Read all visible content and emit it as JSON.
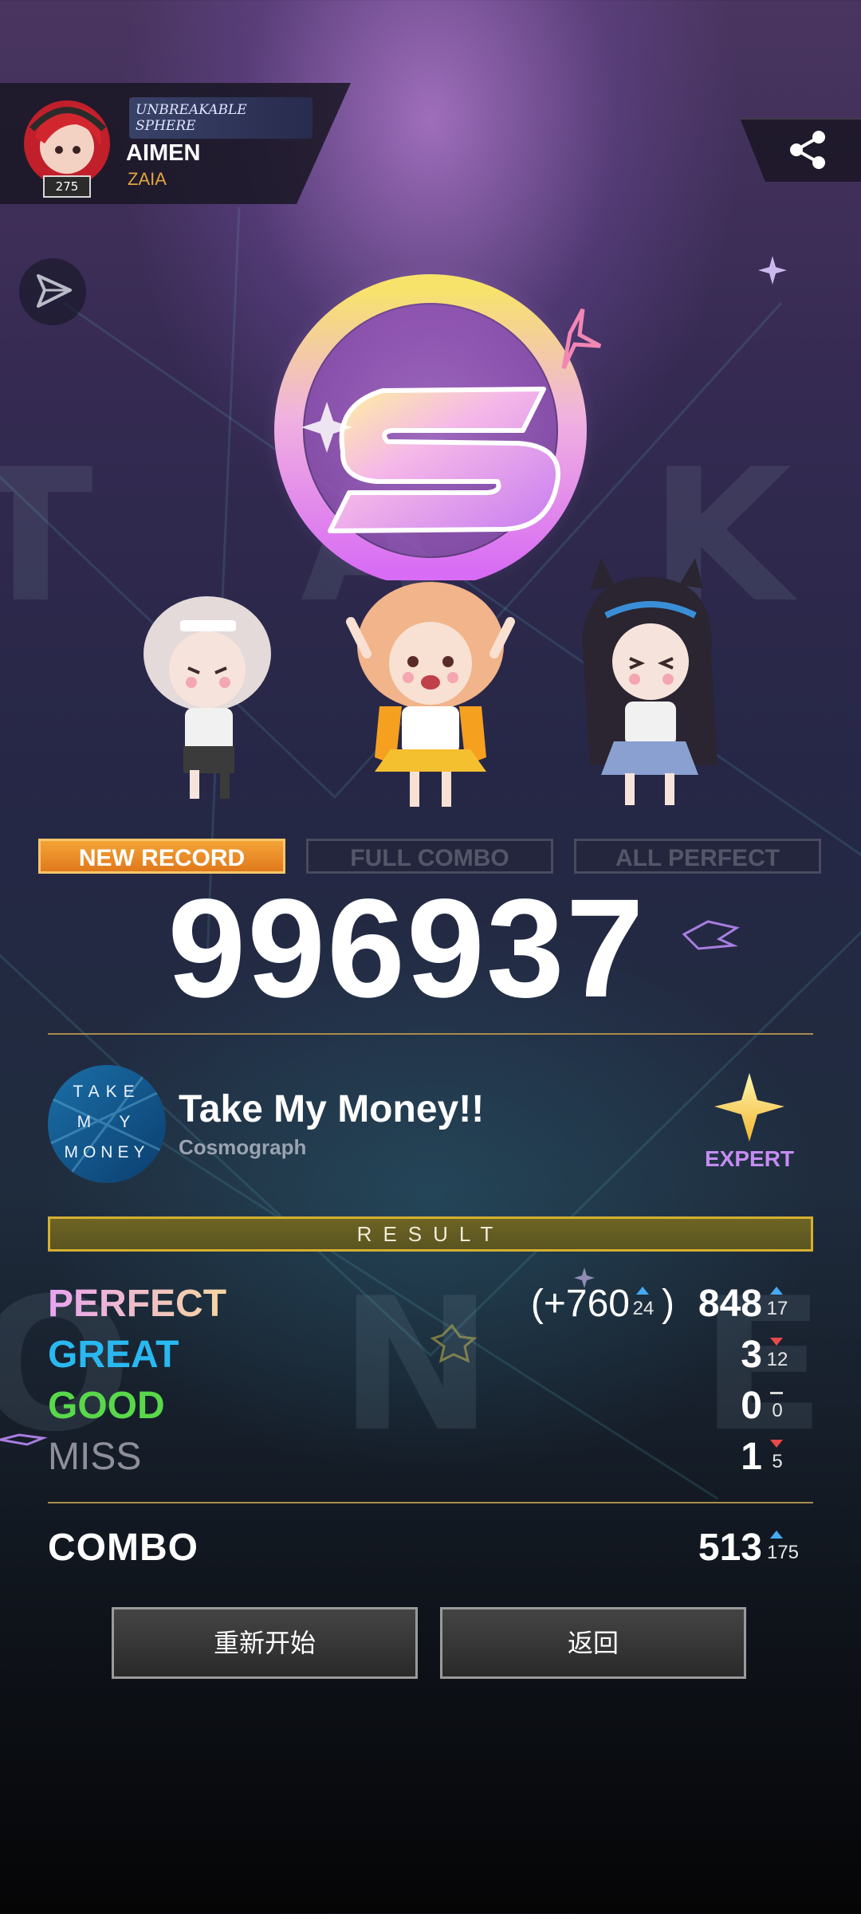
{
  "player": {
    "name": "AIMEN",
    "team": "ZAIA",
    "level": "275",
    "title_tag": "UNBREAKABLE SPHERE"
  },
  "rank": "S",
  "badges": {
    "new_record": "NEW RECORD",
    "full_combo": "FULL COMBO",
    "all_perfect": "ALL PERFECT"
  },
  "badge_state": {
    "new_record": true,
    "full_combo": false,
    "all_perfect": false
  },
  "score": "996937",
  "song": {
    "title": "Take My Money!!",
    "artist": "Cosmograph",
    "difficulty": "EXPERT",
    "jacket_text": [
      "TAKE",
      "M  Y",
      "MONEY"
    ]
  },
  "result_header": "RESULT",
  "judgements": {
    "perfect": {
      "label": "PERFECT",
      "bonus": "(+760",
      "bonus_delta": "24",
      "bonus_close": ")",
      "count": "848",
      "delta": "17",
      "trend": "up"
    },
    "great": {
      "label": "GREAT",
      "count": "3",
      "delta": "12",
      "trend": "down"
    },
    "good": {
      "label": "GOOD",
      "count": "0",
      "delta": "0",
      "trend": "flat"
    },
    "miss": {
      "label": "MISS",
      "count": "1",
      "delta": "5",
      "trend": "down"
    }
  },
  "combo": {
    "label": "COMBO",
    "count": "513",
    "delta": "175",
    "trend": "up"
  },
  "buttons": {
    "restart": "重新开始",
    "back": "返回"
  },
  "colors": {
    "perfect_gradient": [
      "#e8a4f0",
      "#f6d6a0"
    ],
    "great": "#29b8f0",
    "good": "#58d84a",
    "miss": "#8f8f9a",
    "accent_gold": "#d4b030",
    "badge_orange": "#f0952c",
    "expert_purple": "#c58cf2"
  }
}
